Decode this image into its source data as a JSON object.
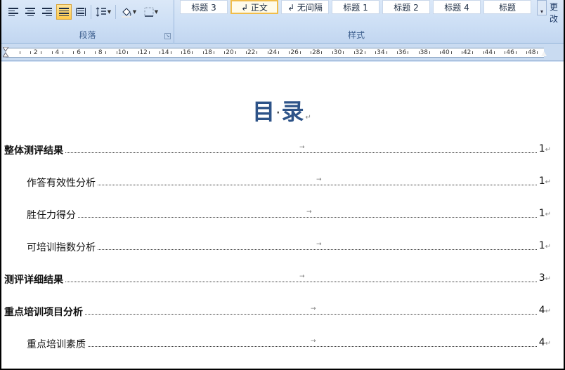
{
  "ribbon": {
    "paragraph_group_label": "段落",
    "styles_group_label": "样式",
    "styles": [
      {
        "label": "标题 3",
        "selected": false
      },
      {
        "label": "↲ 正文",
        "selected": true
      },
      {
        "label": "↲ 无间隔",
        "selected": false
      },
      {
        "label": "标题 1",
        "selected": false
      },
      {
        "label": "标题 2",
        "selected": false
      },
      {
        "label": "标题 4",
        "selected": false
      },
      {
        "label": "标题",
        "selected": false
      }
    ],
    "more_styles_label": "更改",
    "active_align": "justify"
  },
  "ruler": {
    "numbers": [
      "2",
      "4",
      "6",
      "8",
      "10",
      "12",
      "14",
      "16",
      "18",
      "20",
      "22",
      "24",
      "26",
      "28",
      "30",
      "32",
      "34",
      "36",
      "38",
      "40",
      "42",
      "44",
      "46",
      "48"
    ]
  },
  "document": {
    "title_part1": "目",
    "title_dot": "·",
    "title_part2": "录",
    "mark_paragraph": "↵",
    "mark_tab": "→",
    "toc": [
      {
        "text": "整体测评结果",
        "page": "1",
        "level": 1
      },
      {
        "text": "作答有效性分析",
        "page": "1",
        "level": 2
      },
      {
        "text": "胜任力得分",
        "page": "1",
        "level": 2
      },
      {
        "text": "可培训指数分析",
        "page": "1",
        "level": 2
      },
      {
        "text": "测评详细结果",
        "page": "3",
        "level": 1
      },
      {
        "text": "重点培训项目分析",
        "page": "4",
        "level": 1
      },
      {
        "text": "重点培训素质",
        "page": "4",
        "level": 2
      }
    ]
  }
}
